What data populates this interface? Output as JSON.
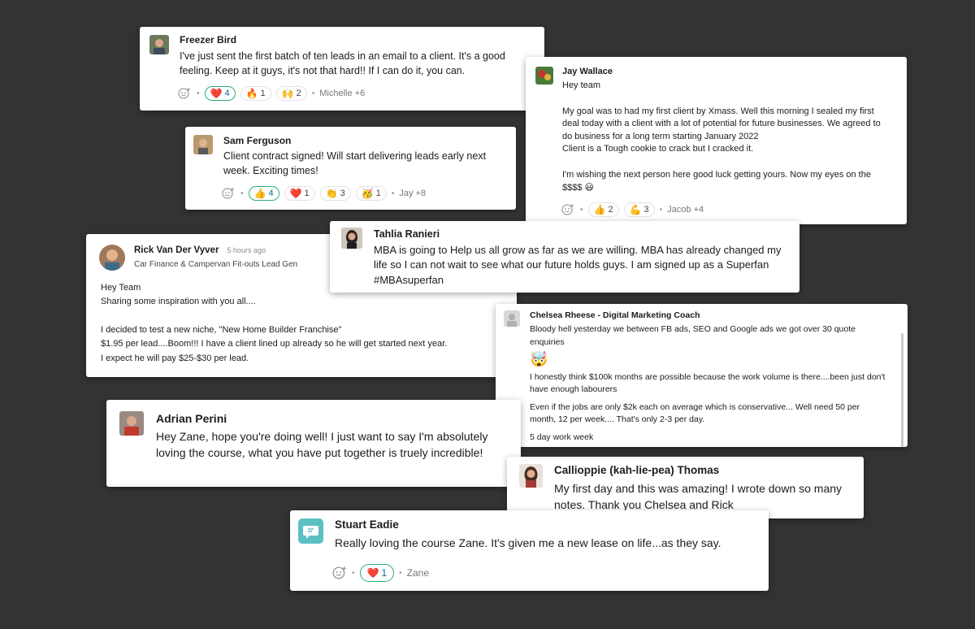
{
  "cards": {
    "freezer": {
      "name": "Freezer Bird",
      "message": "I've just sent the first batch of ten leads in an email to a client. It's a good feeling. Keep at it guys, it's not that hard!! If I can do it, you can.",
      "reactions": [
        {
          "emoji": "❤️",
          "count": "4"
        },
        {
          "emoji": "🔥",
          "count": "1"
        },
        {
          "emoji": "🙌",
          "count": "2"
        }
      ],
      "who": "Michelle +6"
    },
    "sam": {
      "name": "Sam Ferguson",
      "message": "Client contract signed! Will start delivering leads early next week. Exciting times!",
      "reactions": [
        {
          "emoji": "👍",
          "count": "4"
        },
        {
          "emoji": "❤️",
          "count": "1"
        },
        {
          "emoji": "👏",
          "count": "3"
        },
        {
          "emoji": "🥳",
          "count": "1"
        }
      ],
      "who": "Jay +8"
    },
    "jay": {
      "name": "Jay Wallace",
      "line1": "Hey team",
      "line2": "My goal was to had my first client by Xmass. Well this morning I sealed my first deal today with a client with a lot of potential for future businesses. We agreed to do business for a long term starting January 2022",
      "line3": "Client is a Tough cookie to crack but I cracked it.",
      "line4": "I'm wishing the next person here good luck getting yours. Now my eyes on the $$$$ 😃",
      "reactions": [
        {
          "emoji": "👍",
          "count": "2"
        },
        {
          "emoji": "💪",
          "count": "3"
        }
      ],
      "who": "Jacob +4"
    },
    "tahlia": {
      "name": "Tahlia Ranieri",
      "message": "MBA is going to Help us all grow as far as we are willing. MBA has already changed my life so I can not wait to see what our future holds guys. I am signed up as a Superfan #MBAsuperfan"
    },
    "rick": {
      "name": "Rick Van Der Vyver",
      "time": "5 hours ago",
      "subtitle": "Car Finance & Campervan Fit-outs Lead Gen",
      "line1": "Hey Team",
      "line2": "Sharing some inspiration with you all....",
      "line3": "I decided to test a new niche, \"New Home Builder Franchise\"",
      "line4": "$1.95 per lead....Boom!!! I have a client lined up already so he will get started next year.",
      "line5": "I expect he will pay $25-$30 per lead."
    },
    "chelsea": {
      "name": "Chelsea Rheese - Digital Marketing Coach",
      "line1": "Bloody hell yesterday we between FB ads, SEO and Google ads we got over 30 quote enquiries",
      "emoji": "🤯",
      "line2": "I honestly think $100k months are possible because the work volume is there....been just don't have enough labourers",
      "line3": "Even if the jobs are only $2k each on average which is conservative... Well need 50 per month, 12 per week.... That's only 2-3 per day.",
      "line4": "5 day work week"
    },
    "adrian": {
      "name": "Adrian Perini",
      "message": "Hey Zane, hope you're doing well! I just want to say I'm absolutely loving the course, what you have put together is truely incredible!"
    },
    "calli": {
      "name": "Callioppie (kah-lie-pea) Thomas",
      "message": "My first day and this was amazing! I wrote down so many notes. Thank you Chelsea and Rick"
    },
    "stuart": {
      "name": "Stuart Eadie",
      "message": "Really loving the course Zane. It's given me a new lease on life...as they say.",
      "reactions": [
        {
          "emoji": "❤️",
          "count": "1"
        }
      ],
      "who": "Zane"
    }
  },
  "colors": {
    "background": "#333333",
    "reaction_active_border": "#2bac76",
    "stuart_avatar": "#5bc0c4"
  }
}
